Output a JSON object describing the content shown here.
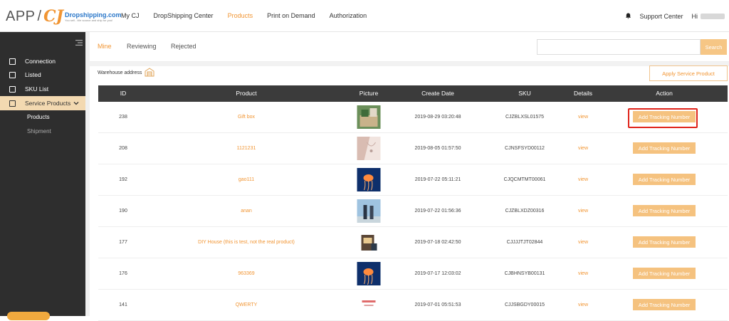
{
  "header": {
    "logo_app": "APP",
    "logo_slash": "/",
    "logo_cj": "CJ",
    "logo_brand": "Dropshipping.com",
    "logo_tagline": "You sell - We source and ship for you!",
    "nav": [
      {
        "label": "My CJ",
        "active": false
      },
      {
        "label": "DropShipping Center",
        "active": false
      },
      {
        "label": "Products",
        "active": true
      },
      {
        "label": "Print on Demand",
        "active": false
      },
      {
        "label": "Authorization",
        "active": false
      }
    ],
    "support_label": "Support Center",
    "hi_label": "Hi"
  },
  "sidebar": {
    "items": [
      {
        "label": "Connection",
        "icon": "connection-icon"
      },
      {
        "label": "Listed",
        "icon": "listed-icon"
      },
      {
        "label": "SKU List",
        "icon": "sku-list-icon"
      },
      {
        "label": "Service Products",
        "icon": "service-products-icon"
      }
    ],
    "sub_items": [
      {
        "label": "Products"
      },
      {
        "label": "Shipment"
      }
    ]
  },
  "tabs": [
    {
      "label": "Mine",
      "active": true
    },
    {
      "label": "Reviewing",
      "active": false
    },
    {
      "label": "Rejected",
      "active": false
    }
  ],
  "search": {
    "placeholder": "",
    "button_label": "Search"
  },
  "warehouse_label": "Warehouse address",
  "apply_button_label": "Apply Service Product",
  "table": {
    "columns": [
      "ID",
      "Product",
      "Picture",
      "Create Date",
      "SKU",
      "Details",
      "Action"
    ],
    "rows": [
      {
        "id": "238",
        "product": "Gift box",
        "picture": "gift-box-image",
        "date": "2019-08-29 03:20:48",
        "sku": "CJZBLXSL01575",
        "details": "view",
        "action": "Add Tracking Number"
      },
      {
        "id": "208",
        "product": "1121231",
        "picture": "necklace-image",
        "date": "2019-08-05 01:57:50",
        "sku": "CJNSFSYD00112",
        "details": "view",
        "action": "Add Tracking Number"
      },
      {
        "id": "192",
        "product": "gao111",
        "picture": "jellyfish-image",
        "date": "2019-07-22 05:11:21",
        "sku": "CJQCMTMT00061",
        "details": "view",
        "action": "Add Tracking Number"
      },
      {
        "id": "190",
        "product": "anan",
        "picture": "couple-image",
        "date": "2019-07-22 01:56:36",
        "sku": "CJZBLXDZ00316",
        "details": "view",
        "action": "Add Tracking Number"
      },
      {
        "id": "177",
        "product": "DIY House (this is test, not the real product)",
        "picture": "diy-house-image",
        "date": "2019-07-18 02:42:50",
        "sku": "CJJJJTJT02844",
        "details": "view",
        "action": "Add Tracking Number"
      },
      {
        "id": "176",
        "product": "963369",
        "picture": "jellyfish-image",
        "date": "2019-07-17 12:03:02",
        "sku": "CJBHNSYB00131",
        "details": "view",
        "action": "Add Tracking Number"
      },
      {
        "id": "141",
        "product": "QWERTY",
        "picture": "text-image",
        "date": "2019-07-01 05:51:53",
        "sku": "CJJSBGDY00015",
        "details": "view",
        "action": "Add Tracking Number"
      }
    ]
  },
  "colors": {
    "accent": "#f19533",
    "button_fill": "#f5c27f",
    "sidebar_bg": "#2e2e2e",
    "table_header_bg": "#3b3b3b",
    "highlight": "#e0231a"
  }
}
